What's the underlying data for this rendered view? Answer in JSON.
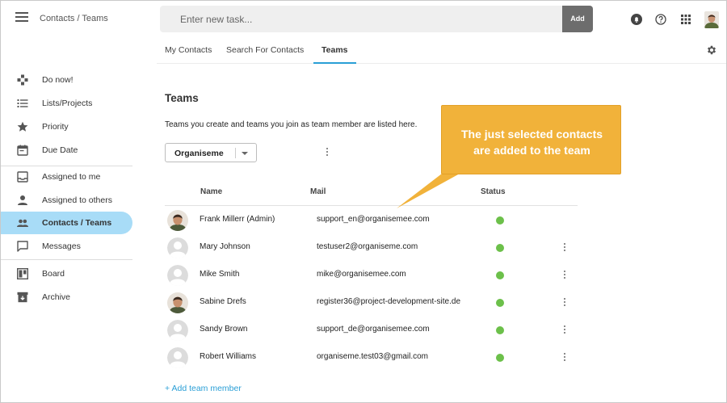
{
  "header": {
    "app_title": "Contacts / Teams",
    "task_placeholder": "Enter new task...",
    "add_label": "Add"
  },
  "tabs": [
    {
      "label": "My Contacts",
      "active": false
    },
    {
      "label": "Search For Contacts",
      "active": false
    },
    {
      "label": "Teams",
      "active": true
    }
  ],
  "sidebar": {
    "items": [
      {
        "label": "Do now!",
        "icon": "gamepad-icon"
      },
      {
        "label": "Lists/Projects",
        "icon": "list-icon"
      },
      {
        "label": "Priority",
        "icon": "star-icon"
      },
      {
        "label": "Due Date",
        "icon": "calendar-icon"
      },
      {
        "label": "Assigned to me",
        "icon": "inbox-icon"
      },
      {
        "label": "Assigned to others",
        "icon": "person-icon"
      },
      {
        "label": "Contacts / Teams",
        "icon": "people-icon",
        "active": true
      },
      {
        "label": "Messages",
        "icon": "chat-icon"
      },
      {
        "label": "Board",
        "icon": "board-icon"
      },
      {
        "label": "Archive",
        "icon": "archive-icon"
      }
    ]
  },
  "main": {
    "title": "Teams",
    "description": "Teams you create and teams you join as team member are listed here.",
    "selected_team": "Organiseme",
    "columns": {
      "name": "Name",
      "mail": "Mail",
      "status": "Status"
    },
    "members": [
      {
        "name": "Frank Millerr (Admin)",
        "mail": "support_en@organisemee.com",
        "status": "online",
        "avatar": "photo",
        "menu": false
      },
      {
        "name": "Mary Johnson",
        "mail": "testuser2@organiseme.com",
        "status": "online",
        "avatar": "placeholder",
        "menu": true
      },
      {
        "name": "Mike Smith",
        "mail": "mike@organisemee.com",
        "status": "online",
        "avatar": "placeholder",
        "menu": true
      },
      {
        "name": "Sabine Drefs",
        "mail": "register36@project-development-site.de",
        "status": "online",
        "avatar": "photo",
        "menu": true
      },
      {
        "name": "Sandy Brown",
        "mail": "support_de@organisemee.com",
        "status": "online",
        "avatar": "placeholder",
        "menu": true
      },
      {
        "name": "Robert Williams",
        "mail": "organiseme.test03@gmail.com",
        "status": "online",
        "avatar": "placeholder",
        "menu": true
      }
    ],
    "add_member_label": "+ Add team member"
  },
  "callout": {
    "line1": "The just selected contacts",
    "line2": "are added to the team"
  },
  "colors": {
    "accent": "#2a9fd6",
    "active_nav": "#a8dcf7",
    "status_online": "#6cc04a",
    "callout": "#f1b23a"
  }
}
